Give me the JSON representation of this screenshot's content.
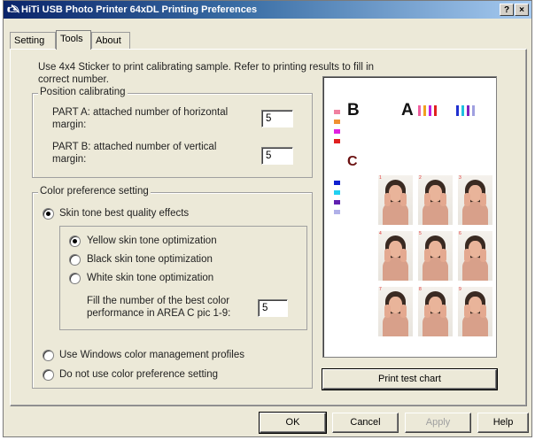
{
  "window": {
    "title": "HiTi USB Photo Printer 64xDL Printing Preferences",
    "help_button": "?",
    "close_button": "×"
  },
  "tabs": [
    {
      "label": "Setting"
    },
    {
      "label": "Tools"
    },
    {
      "label": "About"
    }
  ],
  "instructions": {
    "line1": "Use 4x4 Sticker to print calibrating sample.  Refer to printing results to fill in",
    "line2": "correct number."
  },
  "position_calibrating": {
    "title": "Position calibrating",
    "part_a_line1": "PART A: attached number of horizontal",
    "part_a_line2": "margin:",
    "part_a_value": "5",
    "part_b_line1": "PART B: attached number of vertical",
    "part_b_line2": "margin:",
    "part_b_value": "5"
  },
  "color_preference": {
    "title": "Color preference setting",
    "skin_tone_label": "Skin tone best quality effects",
    "yellow_label": "Yellow skin tone optimization",
    "black_label": "Black skin tone optimization",
    "white_label": "White skin tone optimization",
    "fill_line1": "Fill the number of the best color",
    "fill_line2": "performance in AREA C pic 1-9:",
    "fill_value": "5",
    "windows_cm_label": "Use Windows color management profiles",
    "no_pref_label": "Do not use color preference setting"
  },
  "preview": {
    "label_a": "A",
    "label_b": "B",
    "label_c": "C",
    "photo_numbers": [
      "1",
      "2",
      "3",
      "4",
      "5",
      "6",
      "7",
      "8",
      "9"
    ]
  },
  "buttons": {
    "print_test_chart": "Print test chart",
    "ok": "OK",
    "cancel": "Cancel",
    "apply": "Apply",
    "help": "Help"
  },
  "colors": {
    "title_bar_start": "#0a246a",
    "dialog_bg": "#ece9d8"
  }
}
